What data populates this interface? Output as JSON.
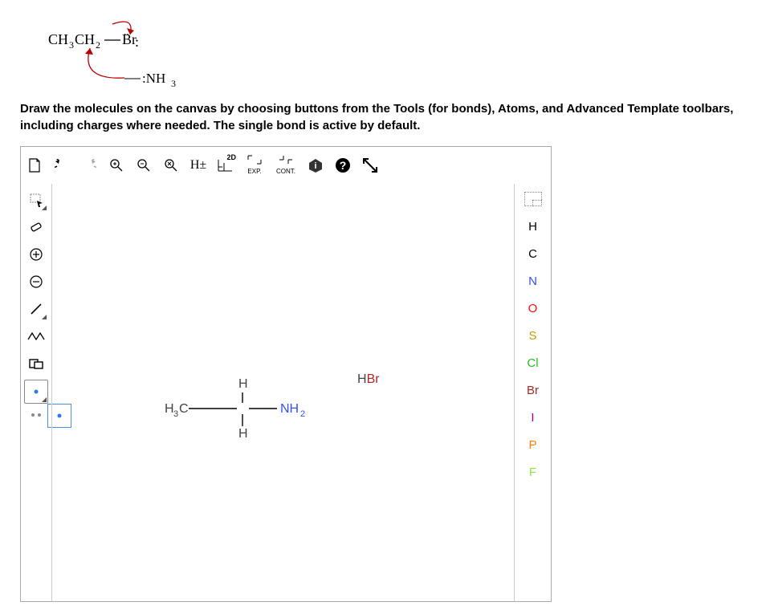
{
  "reaction": {
    "reactant": "CH₃CH₂—B̈r:",
    "reagent": ":NH₃"
  },
  "instruction": "Draw the molecules on the canvas by choosing buttons from the Tools (for bonds), Atoms, and Advanced Template toolbars, including charges where needed. The single bond is active by default.",
  "top_tools": {
    "h_label": "H±",
    "twod_label": "2D",
    "exp_label": "EXP.",
    "cont_label": "CONT."
  },
  "canvas_content": {
    "mol_left": "H₃C",
    "mol_top": "H",
    "mol_bottom": "H",
    "mol_right": "NH₂",
    "mol_free": "HBr"
  },
  "atoms": [
    "H",
    "C",
    "N",
    "O",
    "S",
    "Cl",
    "Br",
    "I",
    "P",
    "F"
  ]
}
